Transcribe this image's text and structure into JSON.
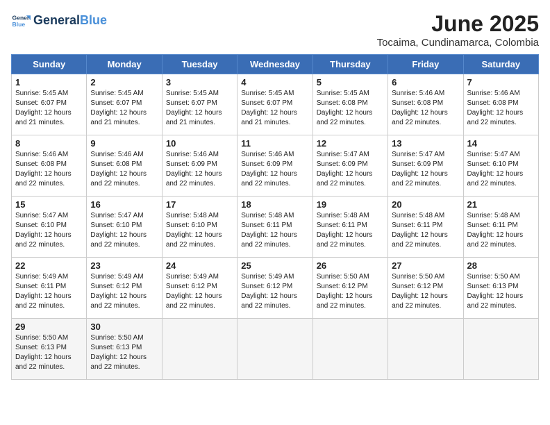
{
  "header": {
    "logo_line1": "General",
    "logo_line2": "Blue",
    "month_year": "June 2025",
    "location": "Tocaima, Cundinamarca, Colombia"
  },
  "weekdays": [
    "Sunday",
    "Monday",
    "Tuesday",
    "Wednesday",
    "Thursday",
    "Friday",
    "Saturday"
  ],
  "weeks": [
    [
      {
        "day": "1",
        "info": "Sunrise: 5:45 AM\nSunset: 6:07 PM\nDaylight: 12 hours\nand 21 minutes."
      },
      {
        "day": "2",
        "info": "Sunrise: 5:45 AM\nSunset: 6:07 PM\nDaylight: 12 hours\nand 21 minutes."
      },
      {
        "day": "3",
        "info": "Sunrise: 5:45 AM\nSunset: 6:07 PM\nDaylight: 12 hours\nand 21 minutes."
      },
      {
        "day": "4",
        "info": "Sunrise: 5:45 AM\nSunset: 6:07 PM\nDaylight: 12 hours\nand 21 minutes."
      },
      {
        "day": "5",
        "info": "Sunrise: 5:45 AM\nSunset: 6:08 PM\nDaylight: 12 hours\nand 22 minutes."
      },
      {
        "day": "6",
        "info": "Sunrise: 5:46 AM\nSunset: 6:08 PM\nDaylight: 12 hours\nand 22 minutes."
      },
      {
        "day": "7",
        "info": "Sunrise: 5:46 AM\nSunset: 6:08 PM\nDaylight: 12 hours\nand 22 minutes."
      }
    ],
    [
      {
        "day": "8",
        "info": "Sunrise: 5:46 AM\nSunset: 6:08 PM\nDaylight: 12 hours\nand 22 minutes."
      },
      {
        "day": "9",
        "info": "Sunrise: 5:46 AM\nSunset: 6:08 PM\nDaylight: 12 hours\nand 22 minutes."
      },
      {
        "day": "10",
        "info": "Sunrise: 5:46 AM\nSunset: 6:09 PM\nDaylight: 12 hours\nand 22 minutes."
      },
      {
        "day": "11",
        "info": "Sunrise: 5:46 AM\nSunset: 6:09 PM\nDaylight: 12 hours\nand 22 minutes."
      },
      {
        "day": "12",
        "info": "Sunrise: 5:47 AM\nSunset: 6:09 PM\nDaylight: 12 hours\nand 22 minutes."
      },
      {
        "day": "13",
        "info": "Sunrise: 5:47 AM\nSunset: 6:09 PM\nDaylight: 12 hours\nand 22 minutes."
      },
      {
        "day": "14",
        "info": "Sunrise: 5:47 AM\nSunset: 6:10 PM\nDaylight: 12 hours\nand 22 minutes."
      }
    ],
    [
      {
        "day": "15",
        "info": "Sunrise: 5:47 AM\nSunset: 6:10 PM\nDaylight: 12 hours\nand 22 minutes."
      },
      {
        "day": "16",
        "info": "Sunrise: 5:47 AM\nSunset: 6:10 PM\nDaylight: 12 hours\nand 22 minutes."
      },
      {
        "day": "17",
        "info": "Sunrise: 5:48 AM\nSunset: 6:10 PM\nDaylight: 12 hours\nand 22 minutes."
      },
      {
        "day": "18",
        "info": "Sunrise: 5:48 AM\nSunset: 6:11 PM\nDaylight: 12 hours\nand 22 minutes."
      },
      {
        "day": "19",
        "info": "Sunrise: 5:48 AM\nSunset: 6:11 PM\nDaylight: 12 hours\nand 22 minutes."
      },
      {
        "day": "20",
        "info": "Sunrise: 5:48 AM\nSunset: 6:11 PM\nDaylight: 12 hours\nand 22 minutes."
      },
      {
        "day": "21",
        "info": "Sunrise: 5:48 AM\nSunset: 6:11 PM\nDaylight: 12 hours\nand 22 minutes."
      }
    ],
    [
      {
        "day": "22",
        "info": "Sunrise: 5:49 AM\nSunset: 6:11 PM\nDaylight: 12 hours\nand 22 minutes."
      },
      {
        "day": "23",
        "info": "Sunrise: 5:49 AM\nSunset: 6:12 PM\nDaylight: 12 hours\nand 22 minutes."
      },
      {
        "day": "24",
        "info": "Sunrise: 5:49 AM\nSunset: 6:12 PM\nDaylight: 12 hours\nand 22 minutes."
      },
      {
        "day": "25",
        "info": "Sunrise: 5:49 AM\nSunset: 6:12 PM\nDaylight: 12 hours\nand 22 minutes."
      },
      {
        "day": "26",
        "info": "Sunrise: 5:50 AM\nSunset: 6:12 PM\nDaylight: 12 hours\nand 22 minutes."
      },
      {
        "day": "27",
        "info": "Sunrise: 5:50 AM\nSunset: 6:12 PM\nDaylight: 12 hours\nand 22 minutes."
      },
      {
        "day": "28",
        "info": "Sunrise: 5:50 AM\nSunset: 6:13 PM\nDaylight: 12 hours\nand 22 minutes."
      }
    ],
    [
      {
        "day": "29",
        "info": "Sunrise: 5:50 AM\nSunset: 6:13 PM\nDaylight: 12 hours\nand 22 minutes."
      },
      {
        "day": "30",
        "info": "Sunrise: 5:50 AM\nSunset: 6:13 PM\nDaylight: 12 hours\nand 22 minutes."
      },
      {
        "day": "",
        "info": ""
      },
      {
        "day": "",
        "info": ""
      },
      {
        "day": "",
        "info": ""
      },
      {
        "day": "",
        "info": ""
      },
      {
        "day": "",
        "info": ""
      }
    ]
  ]
}
